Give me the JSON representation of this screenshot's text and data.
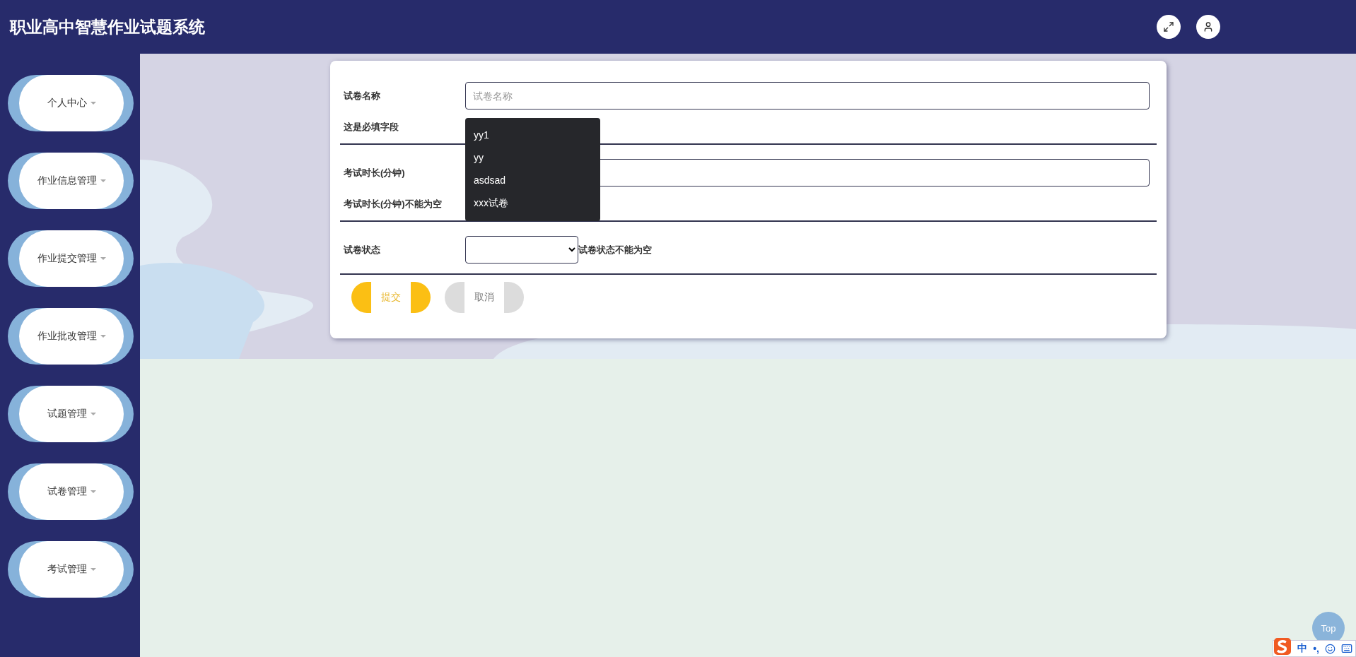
{
  "header": {
    "title": "职业高中智慧作业试题系统"
  },
  "sidebar": {
    "items": [
      {
        "label": "个人中心"
      },
      {
        "label": "作业信息管理"
      },
      {
        "label": "作业提交管理"
      },
      {
        "label": "作业批改管理"
      },
      {
        "label": "试题管理"
      },
      {
        "label": "试卷管理"
      },
      {
        "label": "考试管理"
      }
    ]
  },
  "form": {
    "fields": [
      {
        "kind": "text",
        "label": "试卷名称",
        "placeholder": "试卷名称",
        "error": "这是必填字段"
      },
      {
        "kind": "text",
        "label": "考试时长(分钟)",
        "error": "考试时长(分钟)不能为空"
      },
      {
        "kind": "select",
        "label": "试卷状态",
        "error": "试卷状态不能为空"
      }
    ],
    "suggestions": [
      "yy1",
      "yy",
      "asdsad",
      "xxx试卷"
    ],
    "buttons": [
      {
        "kind": "submit",
        "label": "提交"
      },
      {
        "kind": "cancel",
        "label": "取消"
      }
    ]
  },
  "back_to_top": "Top",
  "ime": {
    "language": "中",
    "punctuation": "•,"
  }
}
